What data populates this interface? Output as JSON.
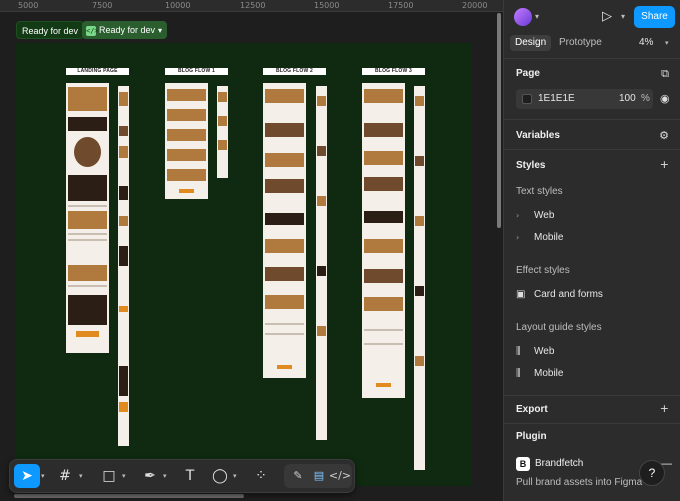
{
  "ruler": {
    "labels": [
      "5000",
      "7500",
      "10000",
      "12500",
      "15000",
      "17500",
      "20000"
    ]
  },
  "canvas": {
    "status_pill": "Ready for dev",
    "status_pill_dropdown": "Ready for dev",
    "column_titles": [
      "LANDING PAGE",
      "BLOG FLOW 1",
      "BLOG FLOW 2",
      "BLOG FLOW 3"
    ],
    "frame_color": "#0f2a10"
  },
  "toolbar": {
    "tools": [
      "move-icon",
      "frame-icon",
      "rectangle-icon",
      "pen-icon",
      "text-icon",
      "comment-icon",
      "actions-icon"
    ],
    "modes": [
      "draw-mode-icon",
      "design-mode-icon",
      "dev-mode-icon"
    ]
  },
  "panel": {
    "share_label": "Share",
    "tabs": {
      "design": "Design",
      "prototype": "Prototype"
    },
    "zoom": "4%",
    "page": {
      "title": "Page",
      "color_hex": "1E1E1E",
      "opacity": "100",
      "opacity_unit": "%"
    },
    "variables": {
      "title": "Variables"
    },
    "styles": {
      "title": "Styles",
      "text_styles_title": "Text styles",
      "text_styles": [
        "Web",
        "Mobile"
      ],
      "effect_styles_title": "Effect styles",
      "effect_styles": [
        "Card and forms"
      ],
      "layout_styles_title": "Layout guide styles",
      "layout_styles": [
        "Web",
        "Mobile"
      ]
    },
    "export": {
      "title": "Export"
    },
    "plugin": {
      "title": "Plugin",
      "name": "Brandfetch",
      "description": "Pull brand assets into Figma"
    },
    "accent_color": "#0d99ff"
  }
}
